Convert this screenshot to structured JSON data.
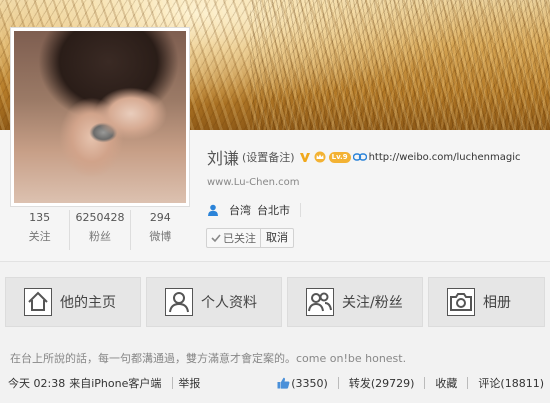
{
  "profile": {
    "name": "刘谦",
    "remark_link": "(设置备注)",
    "level_badge": "Lv.9",
    "weibo_url": "http://weibo.com/luchenmagic",
    "homepage": "www.Lu-Chen.com",
    "location": {
      "region": "台湾",
      "city": "台北市"
    },
    "stats": [
      {
        "value": "135",
        "label": "关注"
      },
      {
        "value": "6250428",
        "label": "粉丝"
      },
      {
        "value": "294",
        "label": "微博"
      }
    ],
    "follow": {
      "followed_label": "已关注",
      "unfollow_label": "取消"
    }
  },
  "nav": {
    "tabs": [
      {
        "label": "他的主页",
        "icon": "home-icon"
      },
      {
        "label": "个人资料",
        "icon": "profile-icon"
      },
      {
        "label": "关注/粉丝",
        "icon": "follow-fans-icon"
      },
      {
        "label": "相册",
        "icon": "camera-icon"
      }
    ]
  },
  "post": {
    "text": "在台上所說的話，每一句都溝通過，雙方滿意才會定案的。come on!be honest.",
    "time": "今天 02:38",
    "source": "来自iPhone客户端",
    "report": "举报",
    "likes": "(3350)",
    "repost": "转发(29729)",
    "favorite": "收藏",
    "comment": "评论(18811)"
  },
  "colors": {
    "badge_orange": "#f3b233",
    "icon_blue": "#2b83d8",
    "link_text": "#333333"
  }
}
